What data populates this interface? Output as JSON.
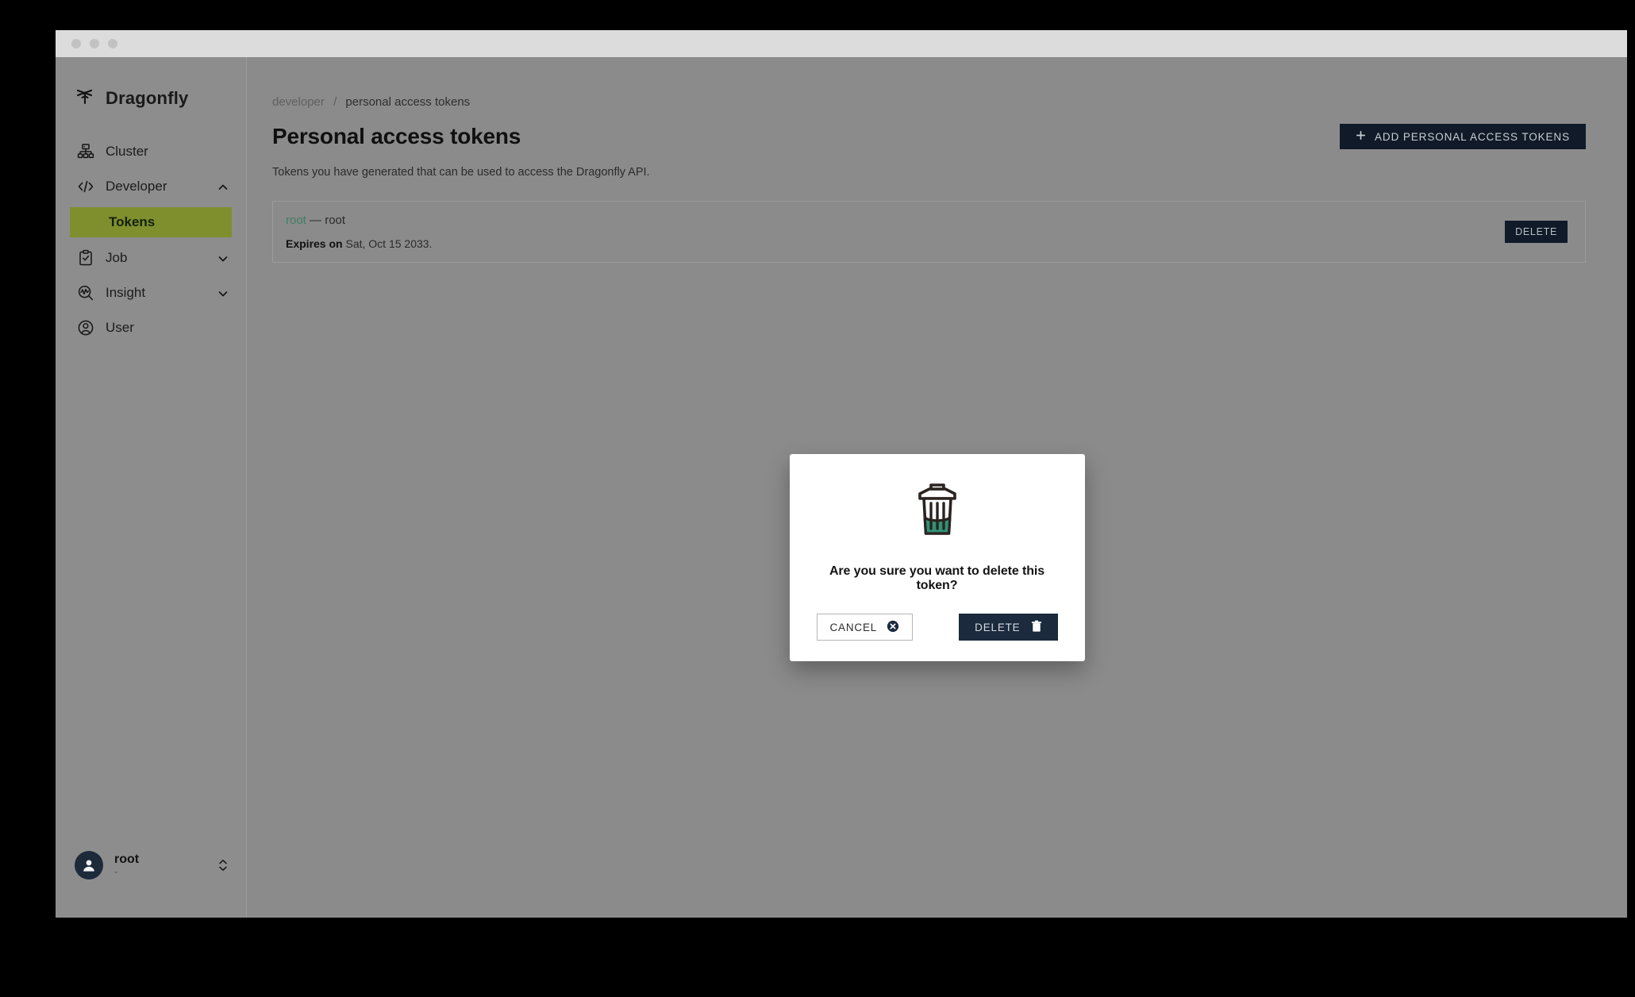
{
  "window": {
    "dots": [
      "close-dot",
      "minimize-dot",
      "maximize-dot"
    ]
  },
  "sidebar": {
    "brand": "Dragonfly",
    "items": [
      {
        "label": "Cluster",
        "icon": "cluster-icon",
        "expandable": false
      },
      {
        "label": "Developer",
        "icon": "code-icon",
        "expandable": true,
        "chevron": "chevron-up-icon"
      },
      {
        "label": "Job",
        "icon": "clipboard-check-icon",
        "expandable": true,
        "chevron": "chevron-down-icon"
      },
      {
        "label": "Insight",
        "icon": "insight-magnifier-icon",
        "expandable": true,
        "chevron": "chevron-down-icon"
      },
      {
        "label": "User",
        "icon": "user-circle-icon",
        "expandable": false
      }
    ],
    "sub_item": {
      "label": "Tokens",
      "parent": "Developer",
      "active": true
    },
    "user": {
      "name": "root",
      "subtitle": "-",
      "avatar": "user-avatar-icon",
      "caret": "chevron-up-down-icon"
    }
  },
  "breadcrumb": {
    "parent": "developer",
    "separator": "/",
    "current": "personal access tokens"
  },
  "page": {
    "title": "Personal access tokens",
    "description": "Tokens you have generated that can be used to access the Dragonfly API.",
    "add_button": {
      "label": "ADD PERSONAL ACCESS TOKENS",
      "icon": "plus-icon"
    }
  },
  "tokens": [
    {
      "name": "root",
      "dash": "—",
      "owner": "root",
      "expires_label": "Expires on",
      "expires_value": "Sat, Oct 15 2033.",
      "delete_label": "DELETE"
    }
  ],
  "modal": {
    "icon": "trash-can-icon",
    "message": "Are you sure you want to delete this token?",
    "cancel": {
      "label": "CANCEL",
      "icon": "circle-x-icon"
    },
    "confirm": {
      "label": "DELETE",
      "icon": "trash-icon"
    }
  },
  "colors": {
    "accent_green": "#7f8f2e",
    "navy": "#101a28",
    "teal": "#2f9377",
    "token_green": "#3d7f63",
    "overlay_gray": "#8b8b8b"
  }
}
